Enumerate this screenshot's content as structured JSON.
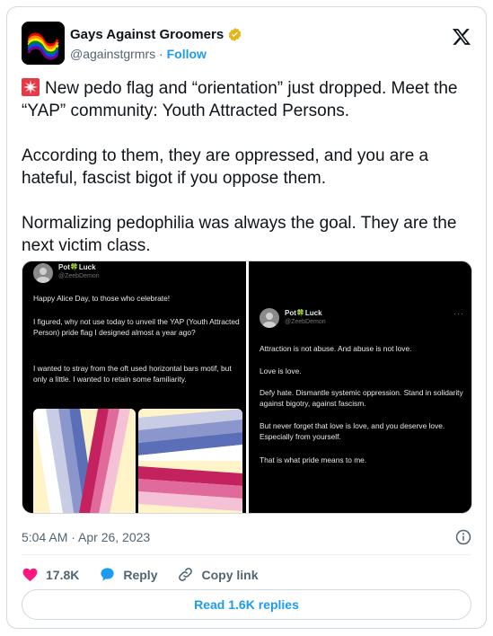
{
  "author": {
    "display_name": "Gays Against Groomers",
    "handle": "@againstgrmrs",
    "separator": "·",
    "follow_label": "Follow",
    "verified_badge": "gold-verified-badge-icon"
  },
  "tweet": {
    "paragraph_1": "New pedo flag and “orientation” just dropped. Meet the “YAP” community: Youth Attracted Persons.",
    "paragraph_2": "According to them, they are oppressed, and you are a hateful, fascist bigot if you oppose them.",
    "paragraph_3": "Normalizing pedophilia was always the goal. They are the next victim class.",
    "lead_icon": "rotating-light-emoji"
  },
  "media": {
    "left": {
      "name": "Pot🍀Luck",
      "handle": "@ZeebDemon",
      "text_1": "Happy Alice Day, to those who celebrate!",
      "text_2": "I figured, why not use today to unveil the YAP (Youth Attracted Person) pride flag I designed almost a year ago?",
      "text_3": "I wanted to stray from the oft used horizontal bars motif, but only a little. I wanted to retain some familiarity."
    },
    "right": {
      "name": "Pot🍀Luck",
      "handle": "@ZeebDemon",
      "more": "···",
      "text_1": "Attraction is not abuse. And abuse is not love.",
      "text_2": "Love is love.",
      "text_3": "Defy hate. Dismantle systemic oppression. Stand in solidarity against bigotry, against fascism.",
      "text_4": "But never forget that love is love, and you deserve love. Especially from yourself.",
      "text_5": "That is what pride means to me."
    }
  },
  "meta": {
    "timestamp": "5:04 AM · Apr 26, 2023"
  },
  "actions": {
    "likes": "17.8K",
    "reply_label": "Reply",
    "copy_label": "Copy link"
  },
  "replies_button": "Read 1.6K replies",
  "colors": {
    "accent": "#1d9bf0",
    "like": "#f91880",
    "text": "#0f1419",
    "muted": "#536471",
    "border": "#cfd9de"
  }
}
